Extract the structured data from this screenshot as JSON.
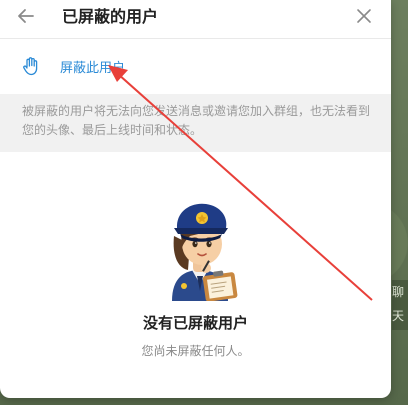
{
  "dialog": {
    "title": "已屏蔽的用户",
    "block_user_label": "屏蔽此用户",
    "info_text": "被屏蔽的用户将无法向您发送消息或邀请您加入群组，也无法看到您的头像、最后上线时间和状态。",
    "empty_title": "没有已屏蔽用户",
    "empty_subtitle": "您尚未屏蔽任何人。"
  },
  "background": {
    "side_text": "聊天"
  },
  "colors": {
    "accent": "#2a8ad6",
    "annotation_arrow": "#e8403a"
  },
  "icons": {
    "back": "arrow-left-icon",
    "close": "close-icon",
    "block": "hand-stop-icon",
    "illustration": "police-officer-sticker"
  }
}
